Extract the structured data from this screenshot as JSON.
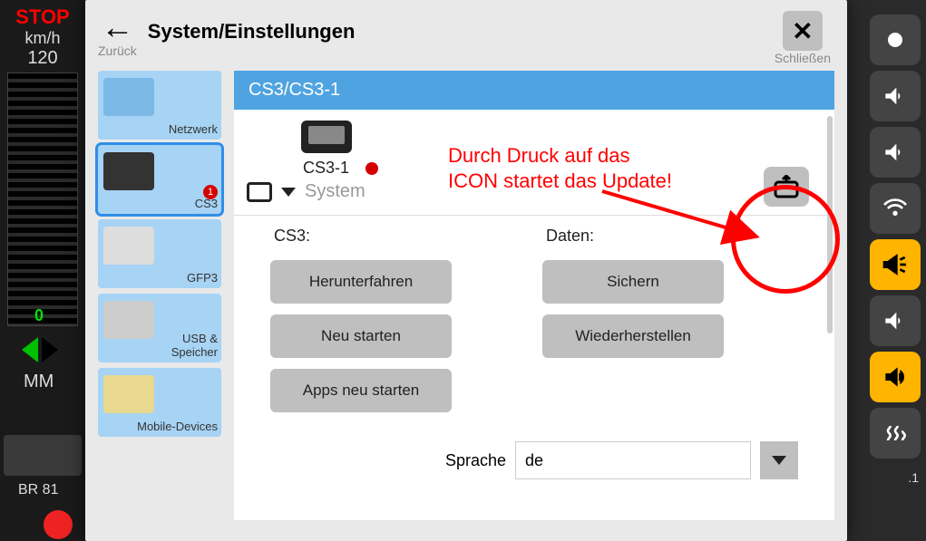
{
  "left": {
    "stop": "STOP",
    "kmh": "km/h",
    "speed": "120",
    "zero": "0",
    "mm": "MM",
    "loco": "BR 81"
  },
  "modal": {
    "back": "Zurück",
    "title": "System/Einstellungen",
    "close": "Schließen"
  },
  "sidebar": {
    "items": [
      {
        "label": "Netzwerk"
      },
      {
        "label": "CS3",
        "badge": "1",
        "selected": true
      },
      {
        "label": "GFP3"
      },
      {
        "label": "USB & Speicher"
      },
      {
        "label": "Mobile-Devices"
      }
    ]
  },
  "content": {
    "header": "CS3/CS3-1",
    "device": "CS3-1",
    "system": "System",
    "cs3_title": "CS3:",
    "daten_title": "Daten:",
    "cs3_buttons": [
      "Herunterfahren",
      "Neu starten",
      "Apps neu starten"
    ],
    "daten_buttons": [
      "Sichern",
      "Wiederherstellen"
    ],
    "lang_label": "Sprache",
    "lang_value": "de"
  },
  "annotation": {
    "text_line1": "Durch Druck auf das",
    "text_line2": "ICON startet das Update!"
  },
  "right_version": ".1"
}
